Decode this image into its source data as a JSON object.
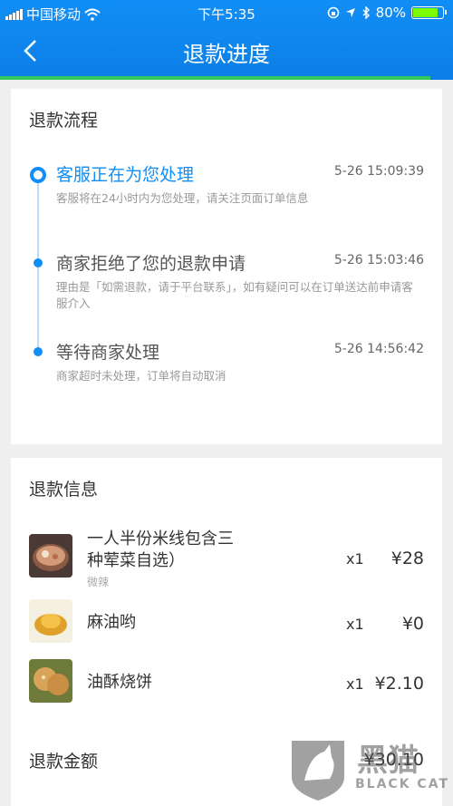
{
  "status_bar": {
    "carrier": "中国移动",
    "time": "下午5:35",
    "battery": "80%"
  },
  "header": {
    "title": "退款进度"
  },
  "refund_flow": {
    "title": "退款流程",
    "steps": [
      {
        "title": "客服正在为您处理",
        "time": "5-26 15:09:39",
        "desc": "客服将在24小时内为您处理，请关注页面订单信息"
      },
      {
        "title": "商家拒绝了您的退款申请",
        "time": "5-26 15:03:46",
        "desc": "理由是「如需退款，请于平台联系」，如有疑问可以在订单送达前申请客服介入"
      },
      {
        "title": "等待商家处理",
        "time": "5-26 14:56:42",
        "desc": "商家超时未处理，订单将自动取消"
      }
    ]
  },
  "refund_info": {
    "title": "退款信息",
    "items": [
      {
        "name_line1": "一人半份米线包含三",
        "name_line2": "种荤菜自选）",
        "sub": "微辣",
        "qty": "x1",
        "price": "¥28"
      },
      {
        "name_line1": "麻油哟",
        "qty": "x1",
        "price": "¥0"
      },
      {
        "name_line1": "油酥烧饼",
        "qty": "x1",
        "price": "¥2.10"
      }
    ],
    "total_label": "退款金额",
    "total_value": "¥30.10"
  },
  "watermark": {
    "brand": "黑猫",
    "brand_en": "BLACK CAT"
  }
}
